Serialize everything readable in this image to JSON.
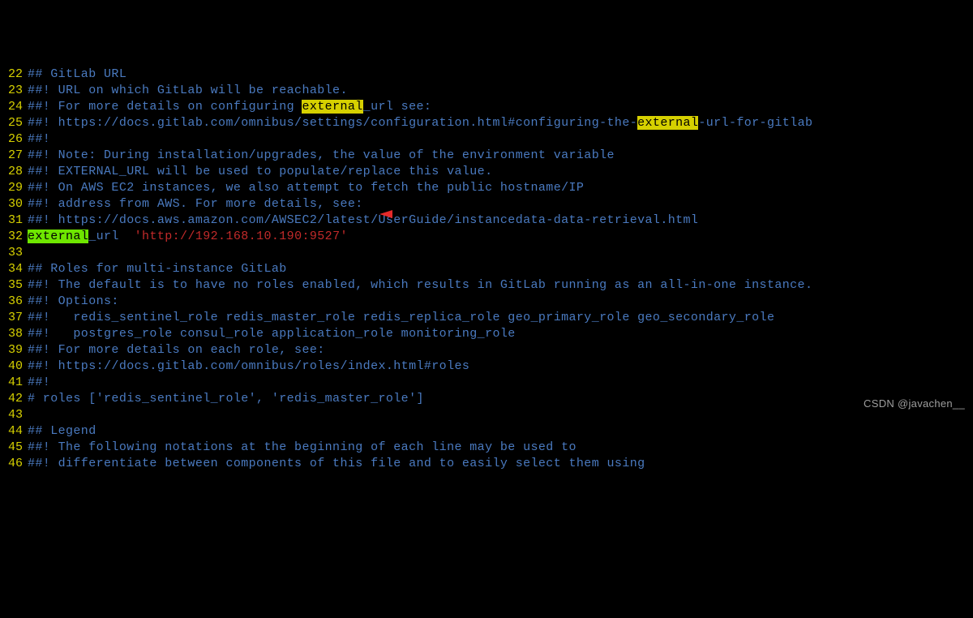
{
  "editor": {
    "lines": [
      {
        "n": 22,
        "segments": [
          {
            "t": "## GitLab URL"
          }
        ]
      },
      {
        "n": 23,
        "segments": [
          {
            "t": "##! URL on which GitLab will be reachable."
          }
        ]
      },
      {
        "n": 24,
        "segments": [
          {
            "t": "##! For more details on configuring "
          },
          {
            "t": "external",
            "cls": "hl"
          },
          {
            "t": "_url see:"
          }
        ]
      },
      {
        "n": 25,
        "segments": [
          {
            "t": "##! https://docs.gitlab.com/omnibus/settings/configuration.html#configuring-the-"
          },
          {
            "t": "external",
            "cls": "hl"
          },
          {
            "t": "-url-for-gitlab"
          }
        ]
      },
      {
        "n": 26,
        "segments": [
          {
            "t": "##!"
          }
        ]
      },
      {
        "n": 27,
        "segments": [
          {
            "t": "##! Note: During installation/upgrades, the value of the environment variable"
          }
        ]
      },
      {
        "n": 28,
        "segments": [
          {
            "t": "##! EXTERNAL_URL will be used to populate/replace this value."
          }
        ]
      },
      {
        "n": 29,
        "segments": [
          {
            "t": "##! On AWS EC2 instances, we also attempt to fetch the public hostname/IP"
          }
        ]
      },
      {
        "n": 30,
        "segments": [
          {
            "t": "##! address from AWS. For more details, see:"
          }
        ]
      },
      {
        "n": 31,
        "segments": [
          {
            "t": "##! https://docs.aws.amazon.com/AWSEC2/latest/UserGuide/instancedata-data-retrieval.html"
          }
        ]
      },
      {
        "n": 32,
        "segments": [
          {
            "t": "external",
            "cls": "hl-green"
          },
          {
            "t": "_url  "
          },
          {
            "t": "'http://192.168.10.190:9527'",
            "cls": "str"
          }
        ]
      },
      {
        "n": 33,
        "segments": [
          {
            "t": ""
          }
        ]
      },
      {
        "n": 34,
        "segments": [
          {
            "t": "## Roles for multi-instance GitLab"
          }
        ]
      },
      {
        "n": 35,
        "segments": [
          {
            "t": "##! The default is to have no roles enabled, which results in GitLab running as an all-in-one instance."
          }
        ]
      },
      {
        "n": 36,
        "segments": [
          {
            "t": "##! Options:"
          }
        ]
      },
      {
        "n": 37,
        "segments": [
          {
            "t": "##!   redis_sentinel_role redis_master_role redis_replica_role geo_primary_role geo_secondary_role"
          }
        ]
      },
      {
        "n": 38,
        "segments": [
          {
            "t": "##!   postgres_role consul_role application_role monitoring_role"
          }
        ]
      },
      {
        "n": 39,
        "segments": [
          {
            "t": "##! For more details on each role, see:"
          }
        ]
      },
      {
        "n": 40,
        "segments": [
          {
            "t": "##! https://docs.gitlab.com/omnibus/roles/index.html#roles"
          }
        ]
      },
      {
        "n": 41,
        "segments": [
          {
            "t": "##!"
          }
        ]
      },
      {
        "n": 42,
        "segments": [
          {
            "t": "# roles ['redis_sentinel_role', 'redis_master_role']"
          }
        ]
      },
      {
        "n": 43,
        "segments": [
          {
            "t": ""
          }
        ]
      },
      {
        "n": 44,
        "segments": [
          {
            "t": "## Legend"
          }
        ]
      },
      {
        "n": 45,
        "segments": [
          {
            "t": "##! The following notations at the beginning of each line may be used to"
          }
        ]
      },
      {
        "n": 46,
        "segments": [
          {
            "t": "##! differentiate between components of this file and to easily select them using"
          }
        ]
      }
    ]
  },
  "annotation": {
    "arrow_color": "#e52a2a"
  },
  "watermark": "CSDN @javachen__"
}
